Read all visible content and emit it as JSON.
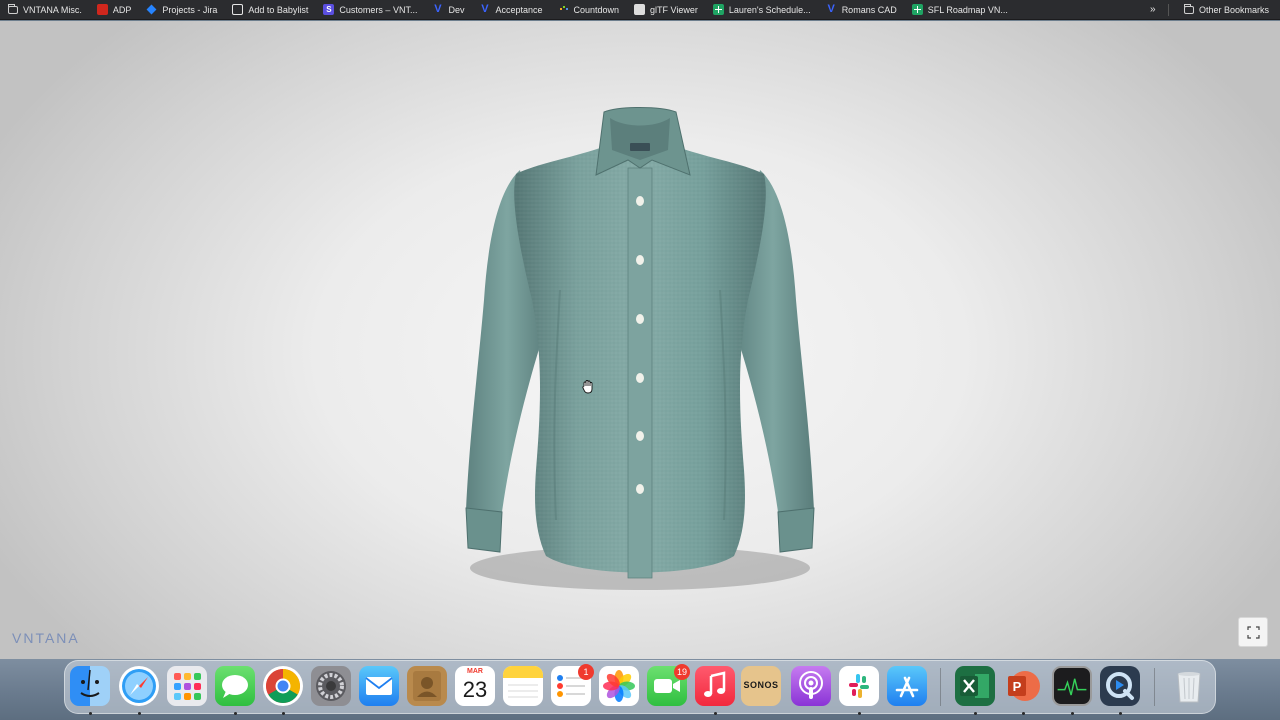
{
  "bookmarks": {
    "items": [
      {
        "label": "VNTANA Misc.",
        "icon": "folder-icon"
      },
      {
        "label": "ADP",
        "icon": "adp-icon"
      },
      {
        "label": "Projects - Jira",
        "icon": "jira-icon"
      },
      {
        "label": "Add to Babylist",
        "icon": "globe-icon"
      },
      {
        "label": "Customers – VNT...",
        "icon": "s-icon"
      },
      {
        "label": "Dev",
        "icon": "vntana-v-icon"
      },
      {
        "label": "Acceptance",
        "icon": "vntana-v-icon"
      },
      {
        "label": "Countdown",
        "icon": "dots-icon"
      },
      {
        "label": "glTF Viewer",
        "icon": "gltf-icon"
      },
      {
        "label": "Lauren's Schedule...",
        "icon": "sheets-icon"
      },
      {
        "label": "Romans CAD",
        "icon": "vntana-v-icon"
      },
      {
        "label": "SFL Roadmap VN...",
        "icon": "sheets-icon"
      }
    ],
    "more": "»",
    "other": "Other Bookmarks"
  },
  "viewer": {
    "logo": "VNTANA"
  },
  "dock": {
    "apps": [
      {
        "name": "Finder",
        "icon": "finder-icon",
        "running": true
      },
      {
        "name": "Safari",
        "icon": "safari-icon",
        "running": true
      },
      {
        "name": "Launchpad",
        "icon": "launchpad-icon",
        "running": false
      },
      {
        "name": "Messages",
        "icon": "messages-icon",
        "running": true
      },
      {
        "name": "Google Chrome",
        "icon": "chrome-icon",
        "running": true
      },
      {
        "name": "System Preferences",
        "icon": "system-preferences-icon",
        "running": false
      },
      {
        "name": "Mail",
        "icon": "mail-icon",
        "running": false
      },
      {
        "name": "Contacts",
        "icon": "contacts-icon",
        "running": false
      },
      {
        "name": "Calendar",
        "icon": "calendar-icon",
        "running": false,
        "month": "MAR",
        "day": "23"
      },
      {
        "name": "Notes",
        "icon": "notes-icon",
        "running": false
      },
      {
        "name": "Reminders",
        "icon": "reminders-icon",
        "running": false,
        "badge": "1"
      },
      {
        "name": "Photos",
        "icon": "photos-icon",
        "running": false
      },
      {
        "name": "FaceTime",
        "icon": "facetime-icon",
        "running": false,
        "badge": "19"
      },
      {
        "name": "Music",
        "icon": "music-icon",
        "running": true
      },
      {
        "name": "Sonos",
        "icon": "sonos-icon",
        "running": false,
        "text": "SONOS"
      },
      {
        "name": "Podcasts",
        "icon": "podcasts-icon",
        "running": false
      },
      {
        "name": "Slack",
        "icon": "slack-icon",
        "running": true
      },
      {
        "name": "App Store",
        "icon": "app-store-icon",
        "running": false
      },
      {
        "name": "Microsoft Excel",
        "icon": "excel-icon",
        "running": true
      },
      {
        "name": "Microsoft PowerPoint",
        "icon": "powerpoint-icon",
        "running": true
      },
      {
        "name": "Activity Monitor",
        "icon": "activity-monitor-icon",
        "running": true
      },
      {
        "name": "QuickTime Player",
        "icon": "quicktime-icon",
        "running": true
      },
      {
        "name": "Trash",
        "icon": "trash-icon",
        "running": false
      }
    ]
  },
  "colors": {
    "shirt": "#6f9592",
    "shirt_shadow": "#4b6c6b",
    "logo": "#7c8fb8",
    "bookmarks_bg": "#2b2c2f"
  }
}
